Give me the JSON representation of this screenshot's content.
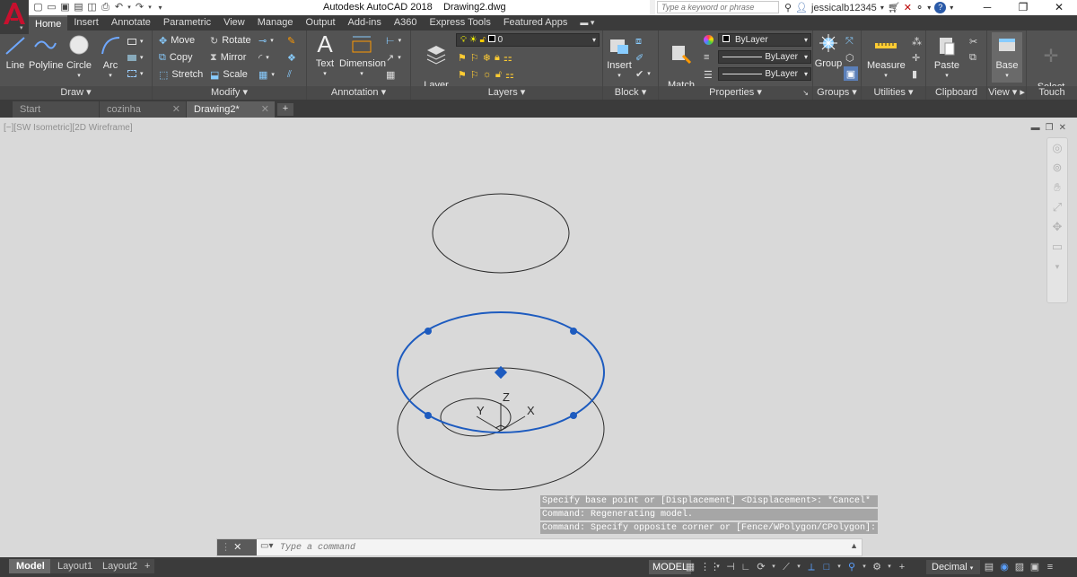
{
  "app": {
    "title": "Autodesk AutoCAD 2018",
    "file": "Drawing2.dwg"
  },
  "search": {
    "placeholder": "Type a keyword or phrase"
  },
  "user": {
    "name": "jessicalb12345"
  },
  "ribbon_tabs": [
    "Home",
    "Insert",
    "Annotate",
    "Parametric",
    "View",
    "Manage",
    "Output",
    "Add-ins",
    "A360",
    "Express Tools",
    "Featured Apps"
  ],
  "draw": {
    "line": "Line",
    "polyline": "Polyline",
    "circle": "Circle",
    "arc": "Arc",
    "label": "Draw"
  },
  "modify": {
    "move": "Move",
    "rotate": "Rotate",
    "copy": "Copy",
    "mirror": "Mirror",
    "stretch": "Stretch",
    "scale": "Scale",
    "label": "Modify"
  },
  "annotation": {
    "text": "Text",
    "dimension": "Dimension",
    "label": "Annotation"
  },
  "layers": {
    "layer_properties": "Layer\nProperties",
    "current_layer": "0",
    "label": "Layers"
  },
  "block": {
    "insert": "Insert",
    "label": "Block"
  },
  "properties": {
    "match": "Match\nProperties",
    "color": "ByLayer",
    "linetype": "ByLayer",
    "lineweight": "ByLayer",
    "label": "Properties"
  },
  "groups": {
    "group": "Group",
    "label": "Groups"
  },
  "utilities": {
    "measure": "Measure",
    "label": "Utilities"
  },
  "clipboard": {
    "paste": "Paste",
    "label": "Clipboard"
  },
  "view": {
    "base": "Base",
    "label": "View"
  },
  "touch": {
    "select_mode": "Select\nMode",
    "label": "Touch"
  },
  "doc_tabs": [
    "Start",
    "cozinha",
    "Drawing2*"
  ],
  "viewport": {
    "label": "[−][SW Isometric][2D Wireframe]"
  },
  "command": {
    "history": [
      "Specify base point or [Displacement] <Displacement>: *Cancel*",
      "Command: Regenerating model.",
      "Command: Specify opposite corner or [Fence/WPolygon/CPolygon]:"
    ],
    "placeholder": "Type a command"
  },
  "ucs": {
    "x": "X",
    "y": "Y",
    "z": "Z"
  },
  "layout_tabs": [
    "Model",
    "Layout1",
    "Layout2"
  ],
  "status": {
    "model": "MODEL",
    "units": "Decimal"
  },
  "colors": {
    "selection": "#1d5bbf",
    "ribbon": "#535353",
    "titlebar": "#ffffff",
    "accent_red": "#c8102e"
  }
}
